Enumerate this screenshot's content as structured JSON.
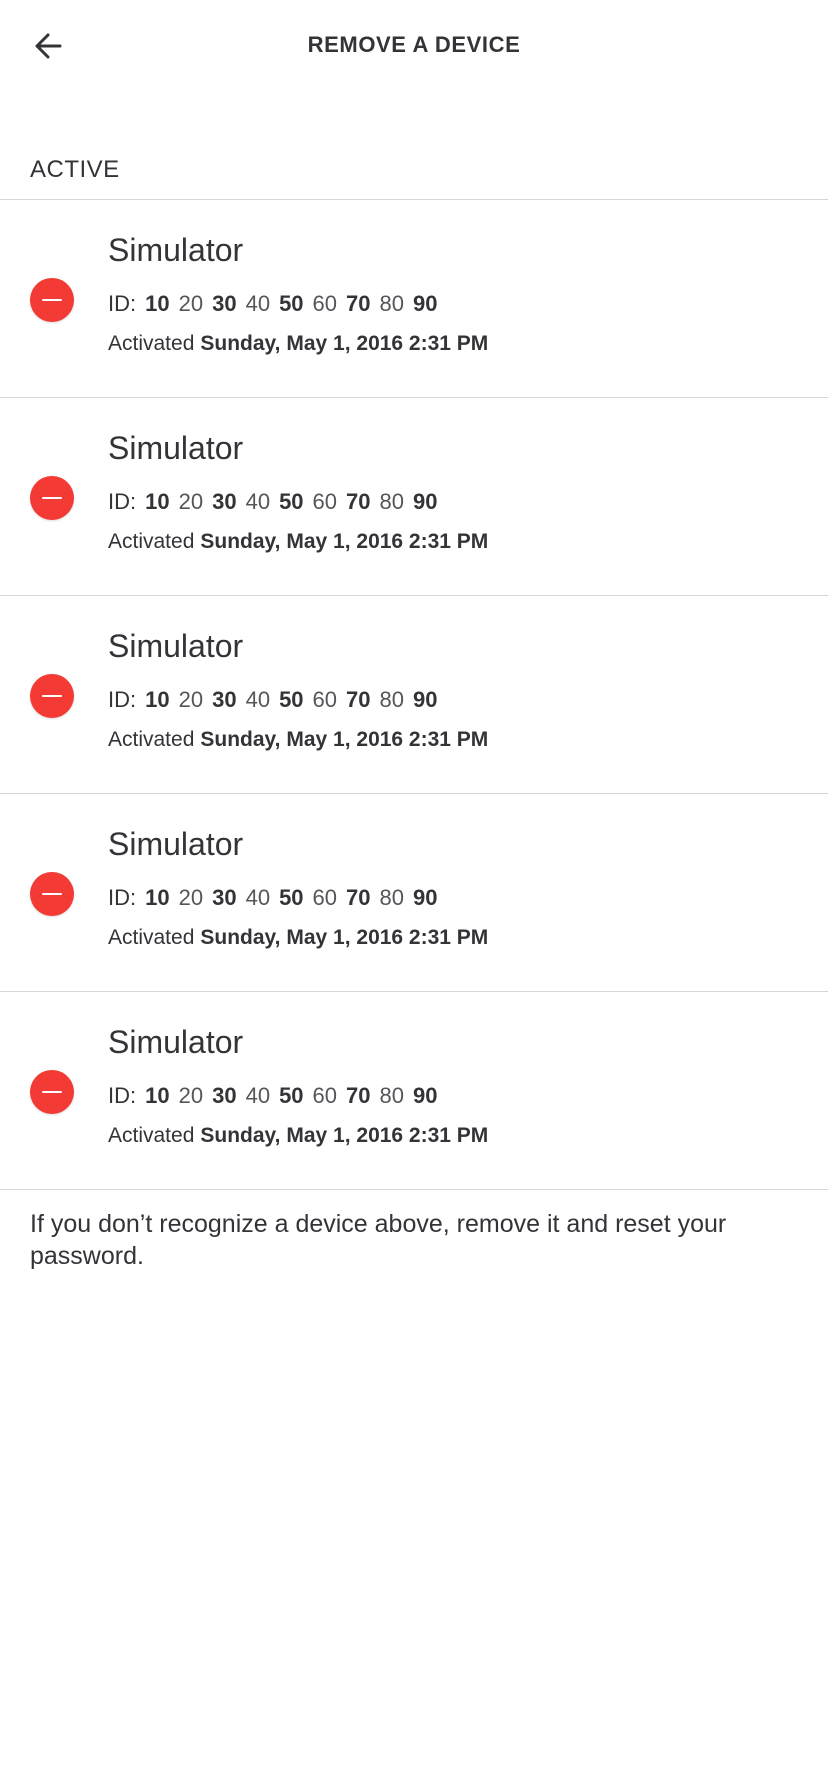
{
  "header": {
    "title": "REMOVE A DEVICE",
    "back_icon": "arrow-left-icon"
  },
  "section": {
    "label": "ACTIVE"
  },
  "devices": [
    {
      "name": "Simulator",
      "id_label": "ID:",
      "id_segments": [
        "10",
        "20",
        "30",
        "40",
        "50",
        "60",
        "70",
        "80",
        "90"
      ],
      "activated_label": "Activated",
      "activated_date": "Sunday, May 1, 2016 2:31 PM"
    },
    {
      "name": "Simulator",
      "id_label": "ID:",
      "id_segments": [
        "10",
        "20",
        "30",
        "40",
        "50",
        "60",
        "70",
        "80",
        "90"
      ],
      "activated_label": "Activated",
      "activated_date": "Sunday, May 1, 2016 2:31 PM"
    },
    {
      "name": "Simulator",
      "id_label": "ID:",
      "id_segments": [
        "10",
        "20",
        "30",
        "40",
        "50",
        "60",
        "70",
        "80",
        "90"
      ],
      "activated_label": "Activated",
      "activated_date": "Sunday, May 1, 2016 2:31 PM"
    },
    {
      "name": "Simulator",
      "id_label": "ID:",
      "id_segments": [
        "10",
        "20",
        "30",
        "40",
        "50",
        "60",
        "70",
        "80",
        "90"
      ],
      "activated_label": "Activated",
      "activated_date": "Sunday, May 1, 2016 2:31 PM"
    },
    {
      "name": "Simulator",
      "id_label": "ID:",
      "id_segments": [
        "10",
        "20",
        "30",
        "40",
        "50",
        "60",
        "70",
        "80",
        "90"
      ],
      "activated_label": "Activated",
      "activated_date": "Sunday, May 1, 2016 2:31 PM"
    }
  ],
  "remove_icon": "minus-circle-icon",
  "footer": {
    "note": "If you don’t recognize a device above, remove it and reset your password."
  },
  "colors": {
    "remove_red": "#f43a34",
    "text": "#333438",
    "divider": "#d6d6d8"
  }
}
